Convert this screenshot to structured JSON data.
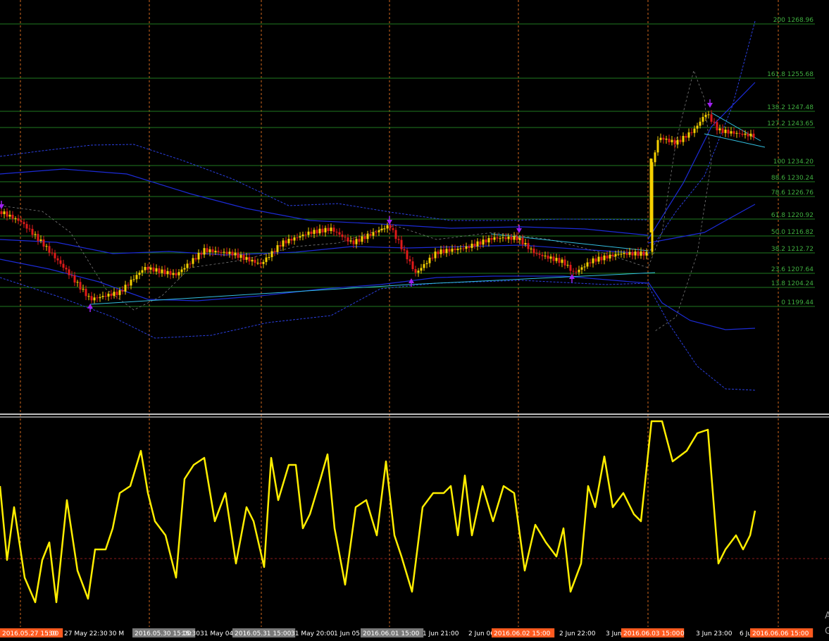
{
  "colors": {
    "background": "#000000",
    "fib_line": "#1f7a1f",
    "fib_text": "#3fae3f",
    "grid_vertical": "#d2691e",
    "separator": "#ffffff",
    "bull_candle": "#f5d000",
    "bear_candle": "#e01a1a",
    "bollinger": "#1c2bd6",
    "envelope": "#2b3fe0",
    "trendline": "#33bfe0",
    "arrow": "#a020f0",
    "oscillator": "#ffee00",
    "osc_baseline": "#8b1c1c",
    "tag_orange": "#ff5a1f",
    "tag_gray": "#7a7a7a"
  },
  "fib_levels": [
    {
      "label": "200 1268.96"
    },
    {
      "label": "161.8 1255.68"
    },
    {
      "label": "138.2 1247.48"
    },
    {
      "label": "127.2 1243.65"
    },
    {
      "label": "100 1234.20"
    },
    {
      "label": "88.6 1230.24"
    },
    {
      "label": "78.6 1226.76"
    },
    {
      "label": "61.8 1220.92"
    },
    {
      "label": "50.0 1216.82"
    },
    {
      "label": "38.2 1212.72"
    },
    {
      "label": "23.6 1207.64"
    },
    {
      "label": "13.8 1204.24"
    },
    {
      "label": "0 1199.44"
    }
  ],
  "time_axis": [
    {
      "text": "2016.05.27 15:00",
      "tag": "orange"
    },
    {
      "text": ":30",
      "tag": "none"
    },
    {
      "text": "27 May 22:30",
      "tag": "none"
    },
    {
      "text": "30 M",
      "tag": "none"
    },
    {
      "text": "2016.05.30 15:00",
      "tag": "gray"
    },
    {
      "text": "15:30",
      "tag": "none"
    },
    {
      "text": "31 May 04:",
      "tag": "none"
    },
    {
      "text": "2016.05.31 15:00",
      "tag": "gray"
    },
    {
      "text": "31 May 20:00",
      "tag": "none"
    },
    {
      "text": "1 Jun 05:0",
      "tag": "none"
    },
    {
      "text": "2016.06.01 15:00",
      "tag": "gray"
    },
    {
      "text": "1 Jun 21:00",
      "tag": "none"
    },
    {
      "text": "2 Jun 06",
      "tag": "none"
    },
    {
      "text": "2016.06.02 15:00",
      "tag": "orange"
    },
    {
      "text": "2 Jun 22:00",
      "tag": "none"
    },
    {
      "text": "3 Jun",
      "tag": "none"
    },
    {
      "text": "2016.06.03 15:00",
      "tag": "orange"
    },
    {
      "text": "0",
      "tag": "none"
    },
    {
      "text": "3 Jun 23:00",
      "tag": "none"
    },
    {
      "text": "6 Ju",
      "tag": "none"
    },
    {
      "text": "2016.06.06 15:00",
      "tag": "orange"
    }
  ],
  "corner": {
    "text1": "A",
    "text2": "G"
  }
}
